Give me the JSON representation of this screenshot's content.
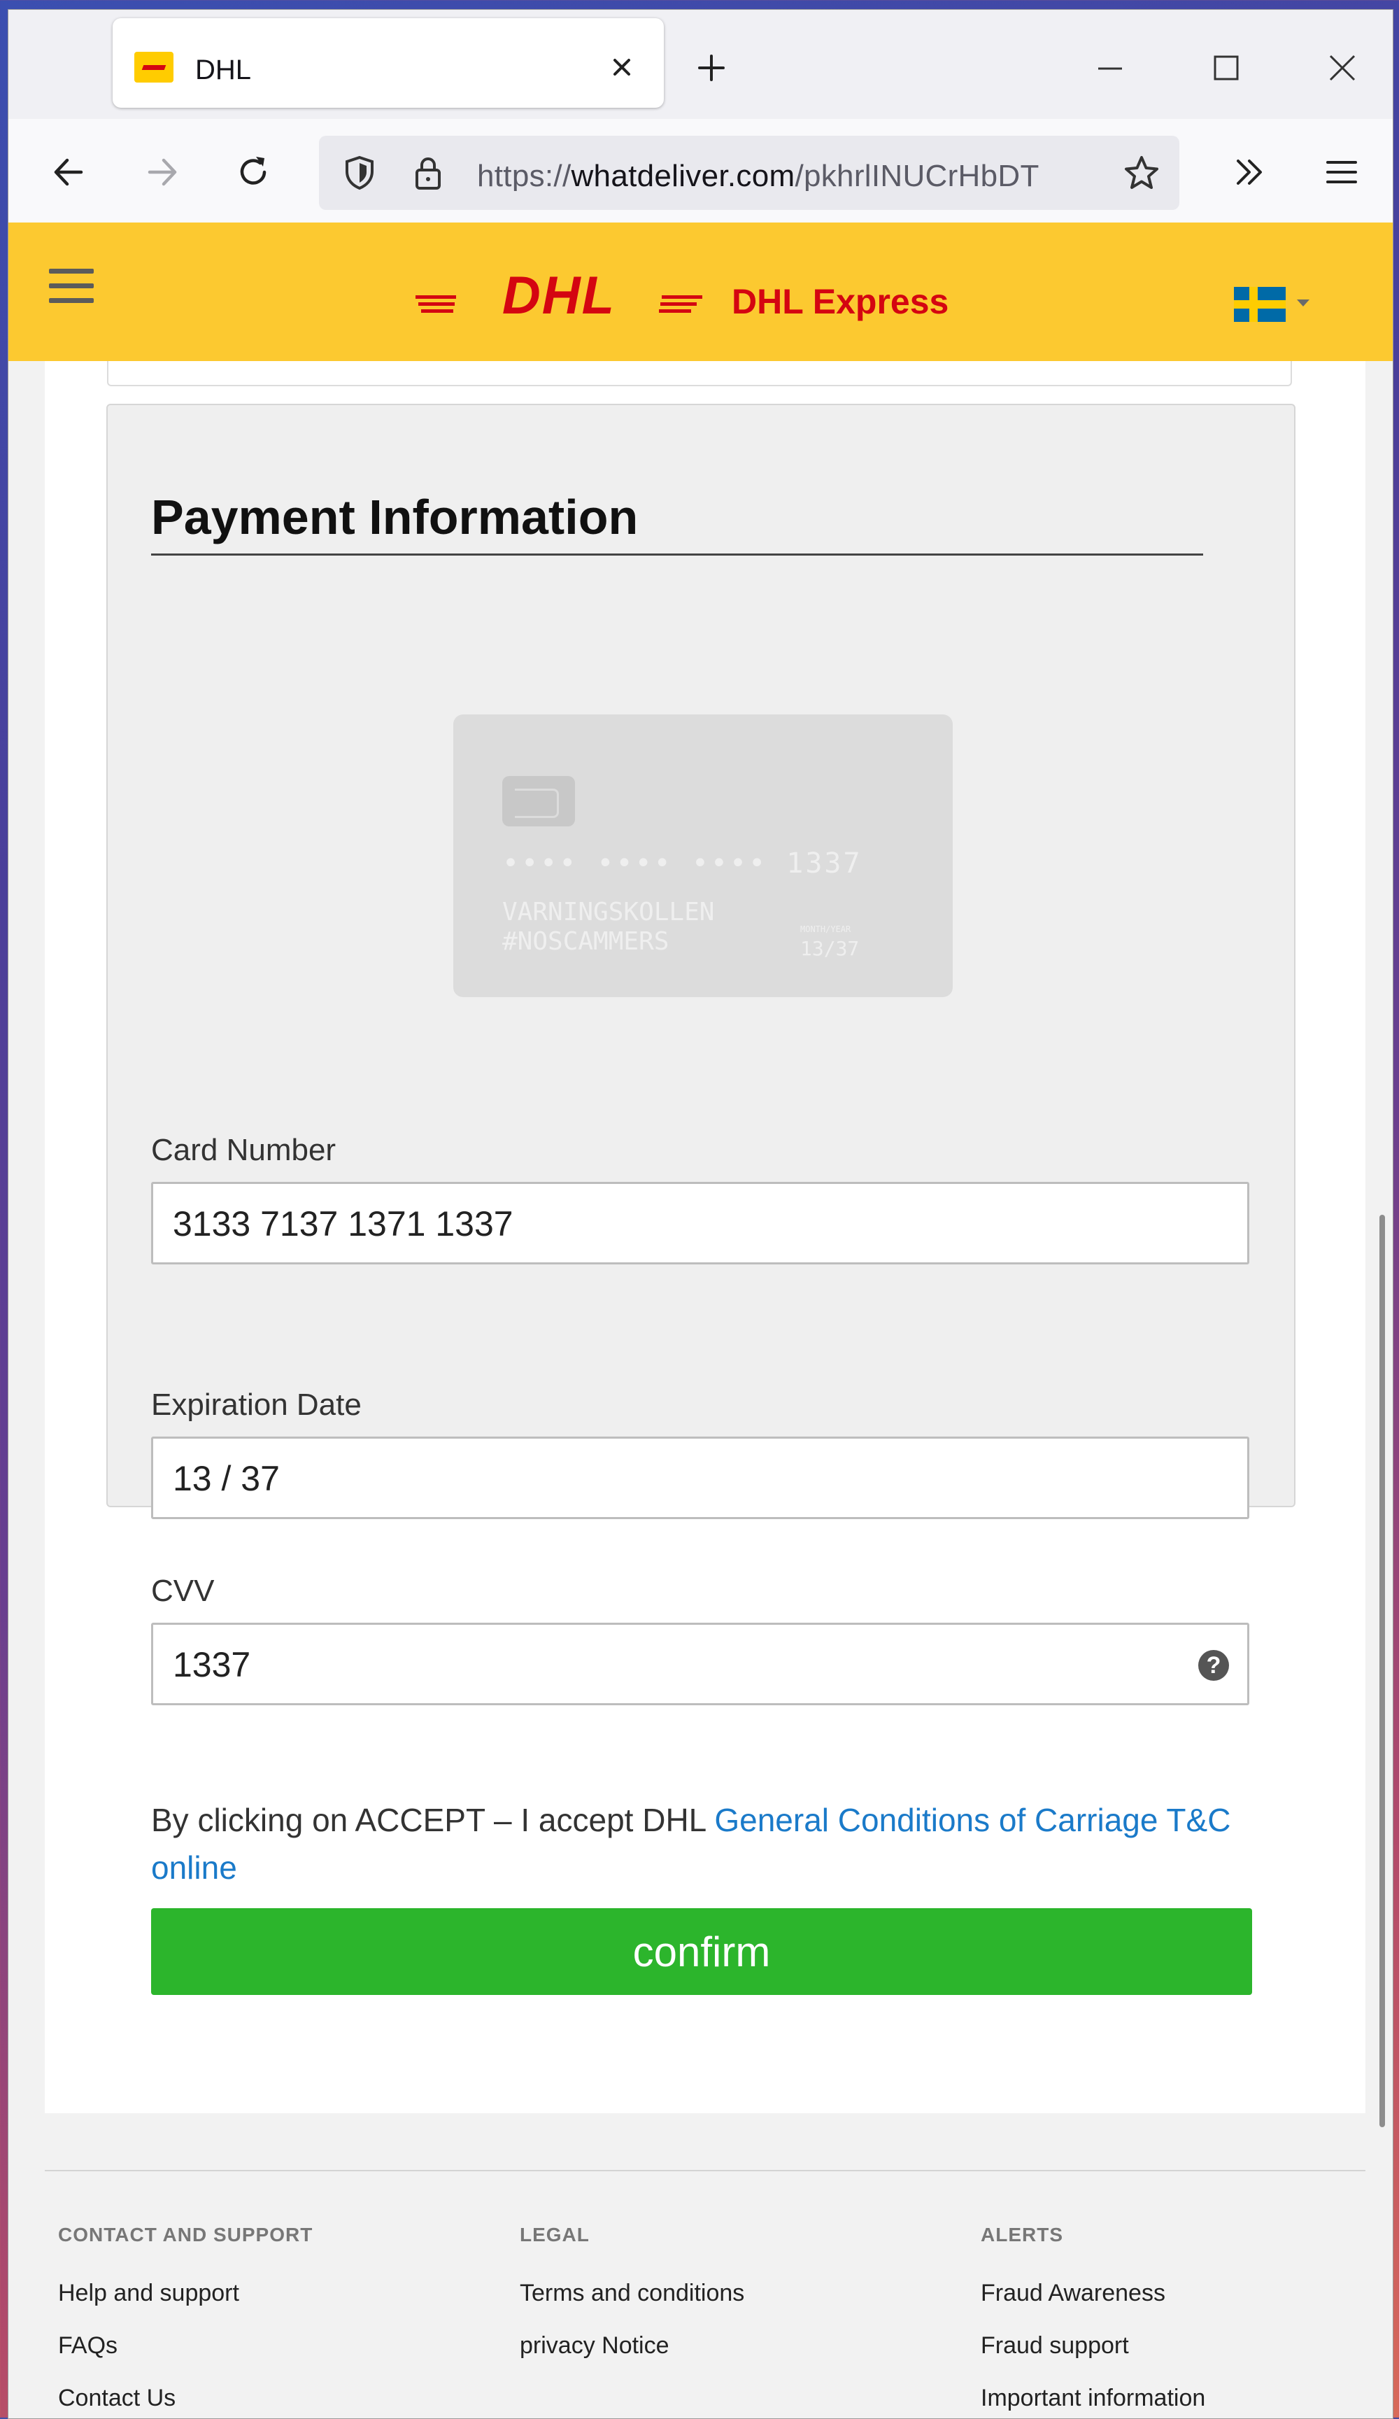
{
  "browser": {
    "tab_title": "DHL",
    "url_prefix": "https://",
    "url_domain": "whatdeliver.com",
    "url_path": "/pkhrlINUCrHbDT"
  },
  "header": {
    "brand_text": "DHL Express",
    "logo_name": "dhl-logo",
    "language_flag": "sweden-flag"
  },
  "payment": {
    "title": "Payment Information",
    "card_preview": {
      "masked_number": "•••• •••• •••• 1337",
      "name_line1": "VARNINGSKOLLEN",
      "name_line2": "#NOSCAMMERS",
      "valid_thru_label": "MONTH/YEAR",
      "expiry": "13/37"
    },
    "card_number_label": "Card Number",
    "card_number_value": "3133 7137 1371 1337",
    "expiration_label": "Expiration Date",
    "expiration_value": "13 / 37",
    "cvv_label": "CVV",
    "cvv_value": "1337",
    "terms_text": "By clicking on ACCEPT – I accept DHL ",
    "terms_link": "General Conditions of Carriage T&C online",
    "confirm_label": "confirm"
  },
  "footer": {
    "columns": [
      {
        "heading": "CONTACT AND SUPPORT",
        "links": [
          "Help and support",
          "FAQs",
          "Contact Us"
        ]
      },
      {
        "heading": "LEGAL",
        "links": [
          "Terms and conditions",
          "privacy Notice"
        ]
      },
      {
        "heading": "ALERTS",
        "links": [
          "Fraud Awareness",
          "Fraud support",
          "Important information"
        ]
      }
    ]
  },
  "colors": {
    "dhl_yellow": "#fcc930",
    "dhl_red": "#d40511",
    "confirm_green": "#2cb52c",
    "link_blue": "#1a7ac9"
  }
}
